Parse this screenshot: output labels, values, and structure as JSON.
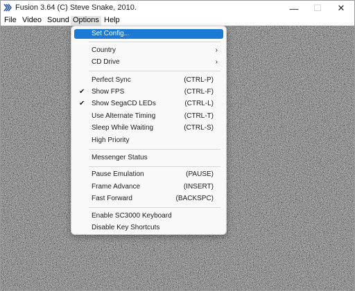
{
  "window": {
    "title": "Fusion 3.64 (C) Steve Snake, 2010."
  },
  "window_controls": {
    "minimize": "—",
    "maximize": "☐",
    "close": "✕"
  },
  "menubar": {
    "items": [
      "File",
      "Video",
      "Sound",
      "Options",
      "Help"
    ],
    "open_menu": "Options"
  },
  "options_menu": {
    "items": [
      {
        "label": "Set Config...",
        "shortcut": "",
        "checked": false,
        "submenu": false,
        "highlighted": true
      },
      {
        "label": "Country",
        "shortcut": "",
        "checked": false,
        "submenu": true
      },
      {
        "label": "CD Drive",
        "shortcut": "",
        "checked": false,
        "submenu": true
      },
      {
        "label": "Perfect Sync",
        "shortcut": "(CTRL-P)",
        "checked": false,
        "submenu": false
      },
      {
        "label": "Show FPS",
        "shortcut": "(CTRL-F)",
        "checked": true,
        "submenu": false
      },
      {
        "label": "Show SegaCD LEDs",
        "shortcut": "(CTRL-L)",
        "checked": true,
        "submenu": false
      },
      {
        "label": "Use Alternate Timing",
        "shortcut": "(CTRL-T)",
        "checked": false,
        "submenu": false
      },
      {
        "label": "Sleep While Waiting",
        "shortcut": "(CTRL-S)",
        "checked": false,
        "submenu": false
      },
      {
        "label": "High Priority",
        "shortcut": "",
        "checked": false,
        "submenu": false
      },
      {
        "label": "Messenger Status",
        "shortcut": "",
        "checked": false,
        "submenu": false
      },
      {
        "label": "Pause Emulation",
        "shortcut": "(PAUSE)",
        "checked": false,
        "submenu": false
      },
      {
        "label": "Frame Advance",
        "shortcut": "(INSERT)",
        "checked": false,
        "submenu": false
      },
      {
        "label": "Fast Forward",
        "shortcut": "(BACKSPC)",
        "checked": false,
        "submenu": false
      },
      {
        "label": "Enable SC3000 Keyboard",
        "shortcut": "",
        "checked": false,
        "submenu": false
      },
      {
        "label": "Disable Key Shortcuts",
        "shortcut": "",
        "checked": false,
        "submenu": false
      }
    ],
    "check_glyph": "✔",
    "submenu_glyph": "›"
  },
  "colors": {
    "highlight": "#1c7ad4",
    "menu_bg": "#f9f9f9",
    "static_noise_base": "#6e6e6e"
  }
}
